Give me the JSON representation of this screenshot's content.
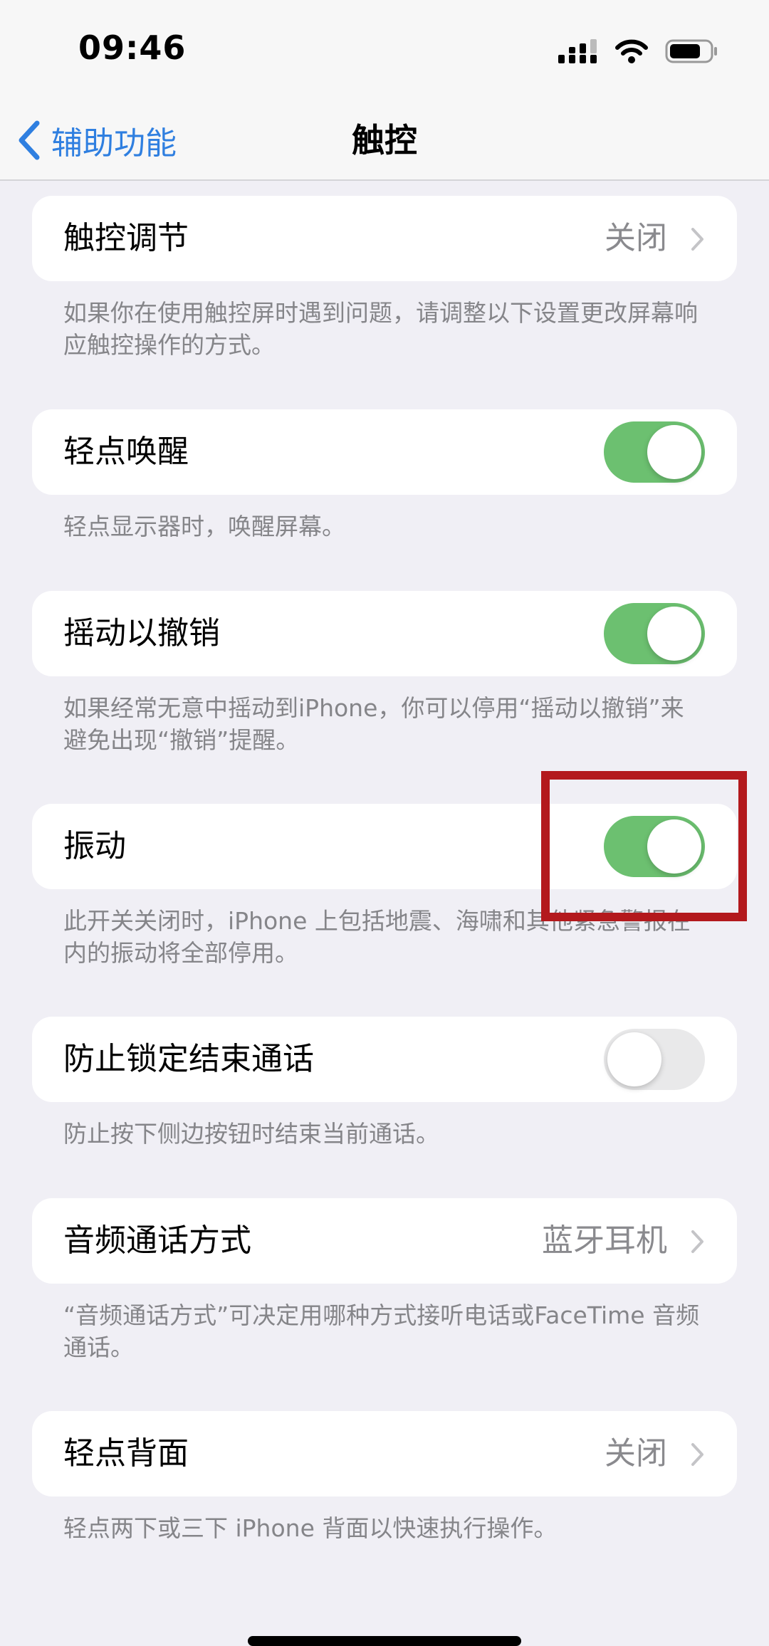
{
  "status_bar": {
    "time": "09:46",
    "icons": [
      "cellular-icon",
      "wifi-icon",
      "battery-icon"
    ]
  },
  "nav": {
    "back_label": "辅助功能",
    "title": "触控"
  },
  "rows": [
    {
      "label": "触控调节",
      "value": "关闭",
      "footnote": "如果你在使用触控屏时遇到问题，请调整以下设置更改屏幕响应触控操作的方式。"
    },
    {
      "label": "轻点唤醒",
      "toggle_on": true,
      "footnote": "轻点显示器时，唤醒屏幕。"
    },
    {
      "label": "摇动以撤销",
      "toggle_on": true,
      "footnote": "如果经常无意中摇动到iPhone，你可以停用“摇动以撤销”来避免出现“撤销”提醒。"
    },
    {
      "label": "振动",
      "toggle_on": true,
      "footnote": "此开关关闭时，iPhone 上包括地震、海啸和其他紧急警报在内的振动将全部停用。"
    },
    {
      "label": "防止锁定结束通话",
      "toggle_on": false,
      "footnote": "防止按下侧边按钮时结束当前通话。"
    },
    {
      "label": "音频通话方式",
      "value": "蓝牙耳机",
      "footnote": "“音频通话方式”可决定用哪种方式接听电话或FaceTime 音频通话。"
    },
    {
      "label": "轻点背面",
      "value": "关闭",
      "footnote": "轻点两下或三下 iPhone 背面以快速执行操作。"
    }
  ],
  "colors": {
    "toggle_on": "#6cc070",
    "toggle_off": "#e9e9ea",
    "accent": "#2f7fe0",
    "highlight_box": "#b3191d"
  }
}
